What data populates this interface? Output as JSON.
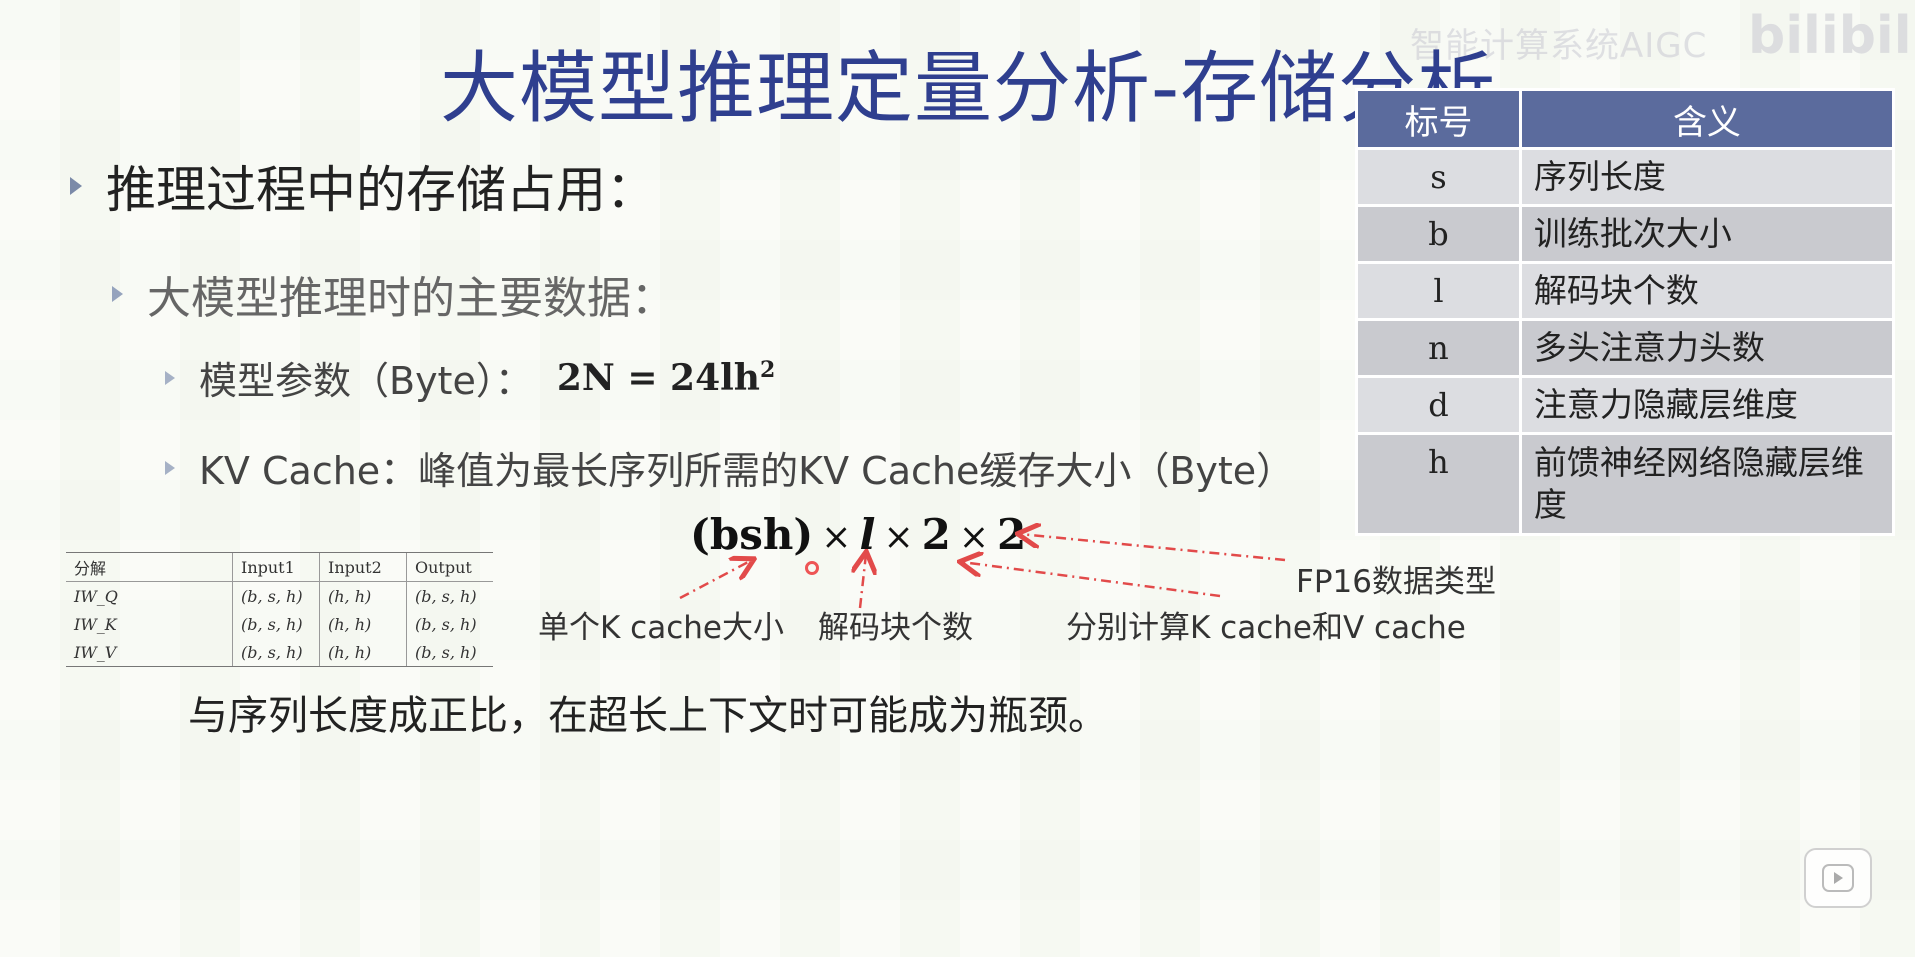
{
  "title": "大模型推理定量分析-存储分析",
  "watermark": "智能计算系统AIGC",
  "watermark_logo": "bilibili",
  "bullets": {
    "l1": "推理过程中的存储占用：",
    "l2": "大模型推理时的主要数据：",
    "l3_params": "模型参数（Byte）：",
    "l3_params_formula": "2N = 24lh",
    "l3_params_exp": "2",
    "l3_kv": "KV Cache：峰值为最长序列所需的KV Cache缓存大小（Byte）"
  },
  "ref_table": {
    "headers": [
      "标号",
      "含义"
    ],
    "rows": [
      {
        "sym": "s",
        "meaning": "序列长度"
      },
      {
        "sym": "b",
        "meaning": "训练批次大小"
      },
      {
        "sym": "l",
        "meaning": "解码块个数"
      },
      {
        "sym": "n",
        "meaning": "多头注意力头数"
      },
      {
        "sym": "d",
        "meaning": "注意力隐藏层维度"
      },
      {
        "sym": "h",
        "meaning": "前馈神经网络隐藏层维度"
      }
    ]
  },
  "small_table": {
    "headers": [
      "分解",
      "Input1",
      "Input2",
      "Output"
    ],
    "rows": [
      [
        "IW_Q",
        "(b, s, h)",
        "(h, h)",
        "(b, s, h)"
      ],
      [
        "IW_K",
        "(b, s, h)",
        "(h, h)",
        "(b, s, h)"
      ],
      [
        "IW_V",
        "(b, s, h)",
        "(h, h)",
        "(b, s, h)"
      ]
    ]
  },
  "kv_formula": {
    "part1": "(bsh)",
    "times": "×",
    "part2": "l",
    "part3": "2",
    "part4": "2"
  },
  "annotations": {
    "k_cache": "单个K cache大小",
    "layers": "解码块个数",
    "kv_sep": "分别计算K cache和V cache",
    "fp16": "FP16数据类型"
  },
  "conclusion": "与序列长度成正比，在超长上下文时可能成为瓶颈。",
  "colors": {
    "title": "#2f3f8f",
    "table_header": "#5b6b9d",
    "arrow": "#e24a4a"
  }
}
